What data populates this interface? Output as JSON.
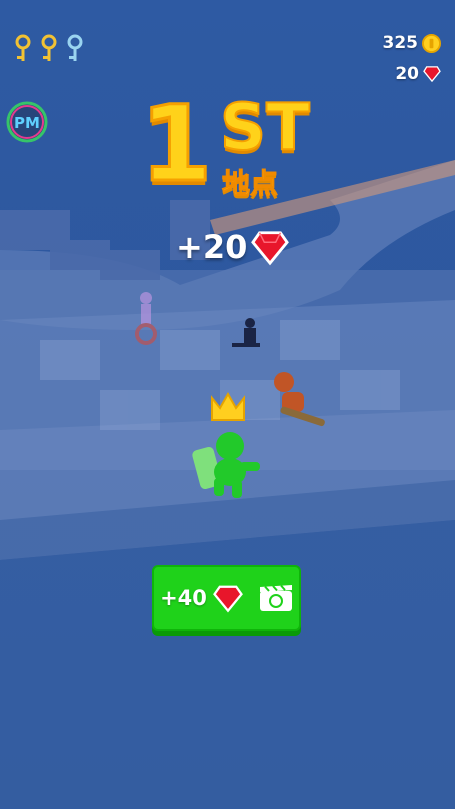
{
  "hud": {
    "keys": [
      "key-gold",
      "key-gold",
      "key-silver"
    ],
    "coins": "325",
    "gems": "20"
  },
  "badge": {
    "label": "PM"
  },
  "place": {
    "number": "1",
    "suffix": "ST",
    "subtitle": "地点"
  },
  "reward": {
    "text": "+20"
  },
  "bonus_button": {
    "text": "+40"
  },
  "colors": {
    "accent_yellow": "#ffd21a",
    "gem_red": "#e8162b",
    "button_green": "#1fd21a",
    "sky": "#2f5ba0"
  },
  "icons": [
    "key-icon",
    "coin-icon",
    "gem-icon",
    "pm-badge-icon",
    "crown-icon",
    "video-ad-icon"
  ]
}
